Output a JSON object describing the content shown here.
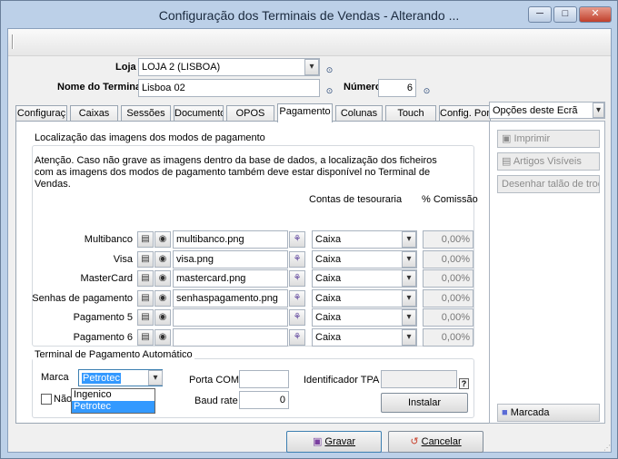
{
  "window": {
    "title": "Configuração dos Terminais de Vendas - Alterando ..."
  },
  "header": {
    "loja_label": "Loja",
    "loja_value": "LOJA 2 (LISBOA)",
    "nome_label": "Nome do Terminal",
    "nome_value": "Lisboa 02",
    "numero_label": "Número",
    "numero_value": "6"
  },
  "tabs": [
    "Configuraç",
    "Caixas",
    "Sessões",
    "Documento",
    "OPOS",
    "Pagamento",
    "Colunas",
    "Touch",
    "Config. Port"
  ],
  "active_tab": "Pagamento",
  "images_group": {
    "title": "Localização das imagens dos modos de pagamento",
    "notice": [
      "Atenção. Caso não grave as imagens dentro da base de dados, a localização dos ficheiros",
      "com as imagens dos modos de pagamento também deve estar disponível no Terminal de",
      "Vendas."
    ],
    "col_contas": "Contas de tesouraria",
    "col_comissao": "% Comissão",
    "rows": [
      {
        "label": "Multibanco",
        "file": "multibanco.png",
        "conta": "Caixa",
        "comissao": "0,00%"
      },
      {
        "label": "Visa",
        "file": "visa.png",
        "conta": "Caixa",
        "comissao": "0,00%"
      },
      {
        "label": "MasterCard",
        "file": "mastercard.png",
        "conta": "Caixa",
        "comissao": "0,00%"
      },
      {
        "label": "Senhas de pagamento",
        "file": "senhaspagamento.png",
        "conta": "Caixa",
        "comissao": "0,00%"
      },
      {
        "label": "Pagamento 5",
        "file": "",
        "conta": "Caixa",
        "comissao": "0,00%"
      },
      {
        "label": "Pagamento 6",
        "file": "",
        "conta": "Caixa",
        "comissao": "0,00%"
      }
    ]
  },
  "tpa_group": {
    "title": "Terminal de Pagamento Automático",
    "marca_label": "Marca",
    "marca_value": "Petrotec",
    "marca_options": [
      "Ingenico",
      "Petrotec"
    ],
    "marca_selected_option": "Petrotec",
    "checkbox_label": "Não",
    "porta_label": "Porta COM",
    "porta_value": "",
    "baud_label": "Baud rate",
    "baud_value": "0",
    "identificador_label": "Identificador TPA",
    "identificador_value": "",
    "help_glyph": "?",
    "instalar_label": "Instalar"
  },
  "side": {
    "title": "Opções deste Ecrã",
    "buttons": [
      "Imprimir",
      "Artigos Visíveis",
      "Desenhar talão de troca"
    ],
    "marcada_label": "Marcada"
  },
  "footer": {
    "gravar_label": "Gravar",
    "cancelar_label": "Cancelar"
  },
  "icons": {
    "minimize": "─",
    "maximize": "□",
    "close": "✕",
    "dropdown": "⌵",
    "search": "🔍"
  }
}
